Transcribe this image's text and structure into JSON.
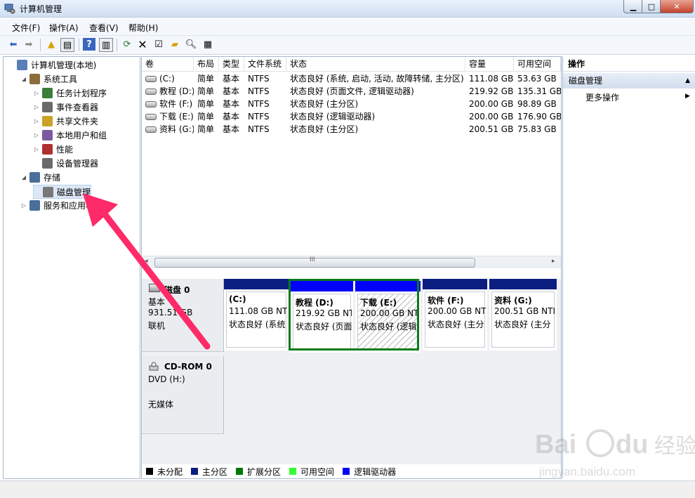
{
  "window": {
    "title": "计算机管理"
  },
  "menu": [
    "文件(F)",
    "操作(A)",
    "查看(V)",
    "帮助(H)"
  ],
  "tree": [
    {
      "label": "计算机管理(本地)",
      "level": 0,
      "expander": "",
      "icon": "computer-management-icon"
    },
    {
      "label": "系统工具",
      "level": 1,
      "expander": "◢",
      "icon": "tools-icon"
    },
    {
      "label": "任务计划程序",
      "level": 2,
      "expander": "▷",
      "icon": "clock-icon"
    },
    {
      "label": "事件查看器",
      "level": 2,
      "expander": "▷",
      "icon": "event-viewer-icon"
    },
    {
      "label": "共享文件夹",
      "level": 2,
      "expander": "▷",
      "icon": "shared-folder-icon"
    },
    {
      "label": "本地用户和组",
      "level": 2,
      "expander": "▷",
      "icon": "users-icon"
    },
    {
      "label": "性能",
      "level": 2,
      "expander": "▷",
      "icon": "performance-icon"
    },
    {
      "label": "设备管理器",
      "level": 2,
      "expander": "",
      "icon": "device-manager-icon"
    },
    {
      "label": "存储",
      "level": 1,
      "expander": "◢",
      "icon": "storage-icon"
    },
    {
      "label": "磁盘管理",
      "level": 2,
      "expander": "",
      "icon": "disk-management-icon",
      "selected": true
    },
    {
      "label": "服务和应用程",
      "level": 1,
      "expander": "▷",
      "icon": "services-icon"
    }
  ],
  "volumes": {
    "headers": [
      "卷",
      "布局",
      "类型",
      "文件系统",
      "状态",
      "容量",
      "可用空间"
    ],
    "rows": [
      [
        "(C:)",
        "简单",
        "基本",
        "NTFS",
        "状态良好 (系统, 启动, 活动, 故障转储, 主分区)",
        "111.08 GB",
        "53.63 GB"
      ],
      [
        "教程 (D:)",
        "简单",
        "基本",
        "NTFS",
        "状态良好 (页面文件, 逻辑驱动器)",
        "219.92 GB",
        "135.31 GB"
      ],
      [
        "软件 (F:)",
        "简单",
        "基本",
        "NTFS",
        "状态良好 (主分区)",
        "200.00 GB",
        "98.89 GB"
      ],
      [
        "下载 (E:)",
        "简单",
        "基本",
        "NTFS",
        "状态良好 (逻辑驱动器)",
        "200.00 GB",
        "176.90 GB"
      ],
      [
        "资料 (G:)",
        "简单",
        "基本",
        "NTFS",
        "状态良好 (主分区)",
        "200.51 GB",
        "75.83 GB"
      ]
    ]
  },
  "scroll_label": "III",
  "disk0": {
    "name": "磁盘 0",
    "type": "基本",
    "size": "931.51 GB",
    "status": "联机",
    "partitions": [
      {
        "name": "(C:)",
        "size": "111.08 GB NT",
        "status": "状态良好 (系统",
        "bar": "#0b1f80"
      },
      {
        "name": "教程 (D:)",
        "size": "219.92 GB NT",
        "status": "状态良好 (页面",
        "bar": "#0000ff"
      },
      {
        "name": "下载 (E:)",
        "size": "200.00 GB NT",
        "status": "状态良好 (逻辑",
        "bar": "#0000ff"
      },
      {
        "name": "软件 (F:)",
        "size": "200.00 GB NT",
        "status": "状态良好 (主分",
        "bar": "#0b1f80"
      },
      {
        "name": "资料 (G:)",
        "size": "200.51 GB NTI",
        "status": "状态良好 (主分",
        "bar": "#0b1f80"
      }
    ]
  },
  "cdrom": {
    "name": "CD-ROM 0",
    "drive": "DVD (H:)",
    "media": "无媒体"
  },
  "legend": [
    {
      "label": "未分配",
      "color": "#000000"
    },
    {
      "label": "主分区",
      "color": "#0b1f80"
    },
    {
      "label": "扩展分区",
      "color": "#007700"
    },
    {
      "label": "可用空间",
      "color": "#33ff33"
    },
    {
      "label": "逻辑驱动器",
      "color": "#0000ff"
    }
  ],
  "actions": {
    "title": "操作",
    "group": "磁盘管理",
    "more": "更多操作"
  },
  "watermark": {
    "brand": "Bai du 经验",
    "url": "jingyan.baidu.com"
  }
}
